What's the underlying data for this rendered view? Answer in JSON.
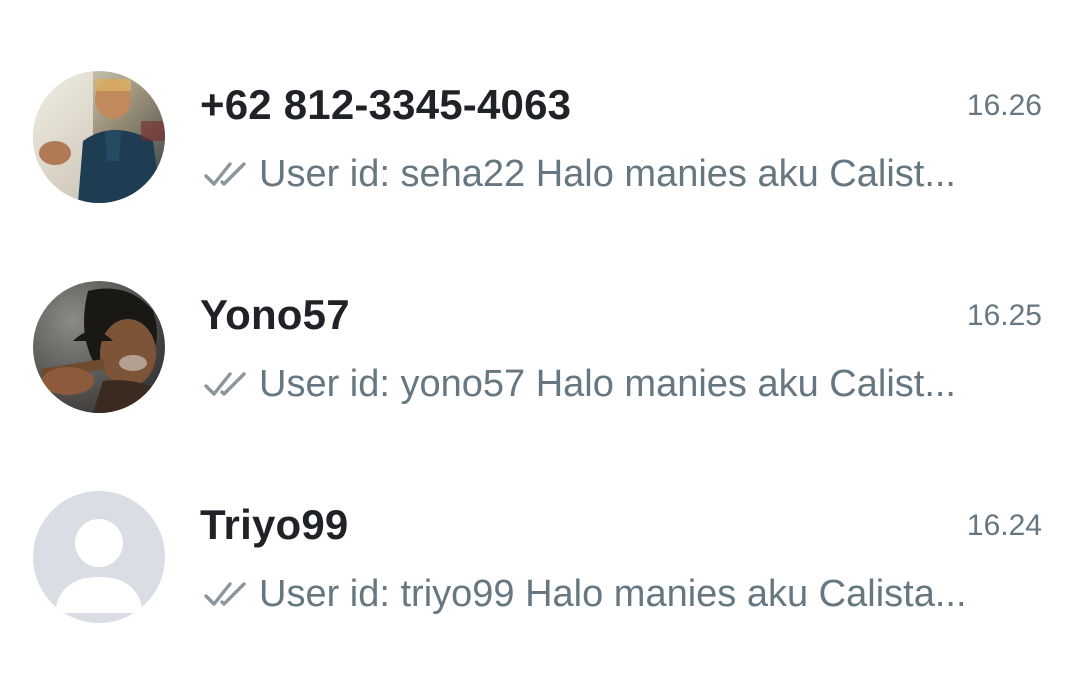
{
  "chats": [
    {
      "name": "+62 812-3345-4063",
      "time": "16.26",
      "preview": "User id: seha22  Halo manies aku Calist...",
      "status_icon": "double-check-icon",
      "avatar": "photo"
    },
    {
      "name": "Yono57",
      "time": "16.25",
      "preview": "User id: yono57  Halo manies aku Calist...",
      "status_icon": "double-check-icon",
      "avatar": "photo"
    },
    {
      "name": "Triyo99",
      "time": "16.24",
      "preview": "User id: triyo99  Halo manies aku Calista...",
      "status_icon": "double-check-icon",
      "avatar": "default-person"
    }
  ],
  "colors": {
    "name": "#1f2328",
    "secondary": "#667781",
    "tick": "#8a959c",
    "default_avatar_bg": "#d8dee3",
    "default_avatar_fg": "#ffffff"
  }
}
